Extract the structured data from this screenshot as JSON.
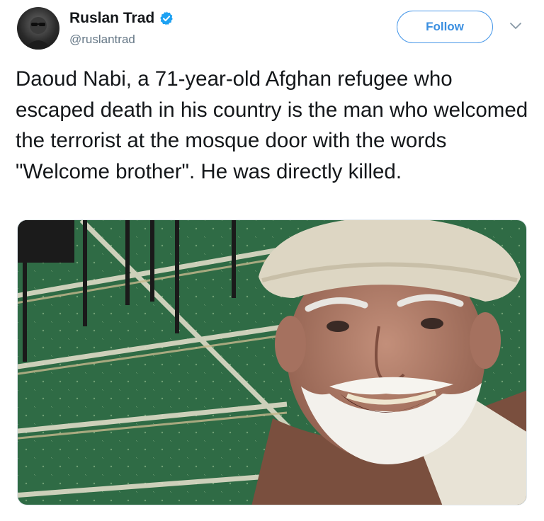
{
  "author": {
    "display_name": "Ruslan Trad",
    "handle": "@ruslantrad",
    "verified": true,
    "avatar_icon": "user-avatar"
  },
  "actions": {
    "follow_label": "Follow",
    "more_icon": "chevron-down-icon"
  },
  "tweet": {
    "text": "Daoud Nabi, a 71-year-old Afghan refugee who escaped death in his country is the man who welcomed the terrorist at the mosque door with the words \"Welcome brother\". He was directly killed."
  },
  "media": {
    "type": "photo"
  },
  "colors": {
    "accent": "#1da1f2",
    "follow_border": "#4a99e9",
    "handle_gray": "#657786",
    "text": "#14171a"
  }
}
